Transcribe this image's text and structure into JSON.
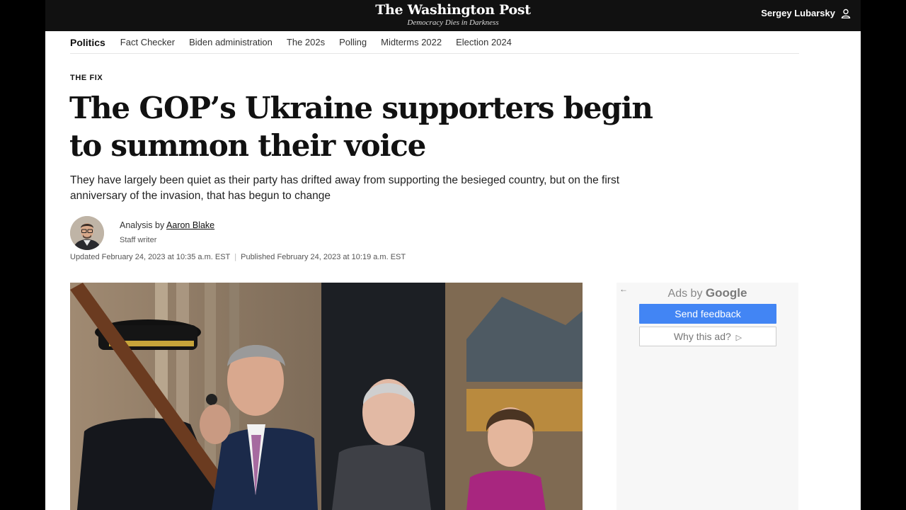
{
  "header": {
    "logo_name": "The Washington Post",
    "logo_tagline": "Democracy Dies in Darkness",
    "user_name": "Sergey Lubarsky"
  },
  "nav": {
    "items": [
      "Politics",
      "Fact Checker",
      "Biden administration",
      "The 202s",
      "Polling",
      "Midterms 2022",
      "Election 2024"
    ]
  },
  "article": {
    "kicker": "THE FIX",
    "headline": "The GOP’s Ukraine supporters begin to summon their voice",
    "dek": "They have largely been quiet as their party has drifted away from supporting the besieged country, but on the first anniversary of the invasion, that has begun to change",
    "byline_prefix": "Analysis by",
    "author": "Aaron Blake",
    "author_role": "Staff writer",
    "updated": "Updated February 24, 2023 at 10:35 a.m. EST",
    "separator": "|",
    "published": "Published February 24, 2023 at 10:19 a.m. EST"
  },
  "ad": {
    "back_glyph": "←",
    "ads_by": "Ads by",
    "provider": "Google",
    "send_feedback": "Send feedback",
    "why_this_ad": "Why this ad?",
    "why_icon_glyph": "▷"
  }
}
